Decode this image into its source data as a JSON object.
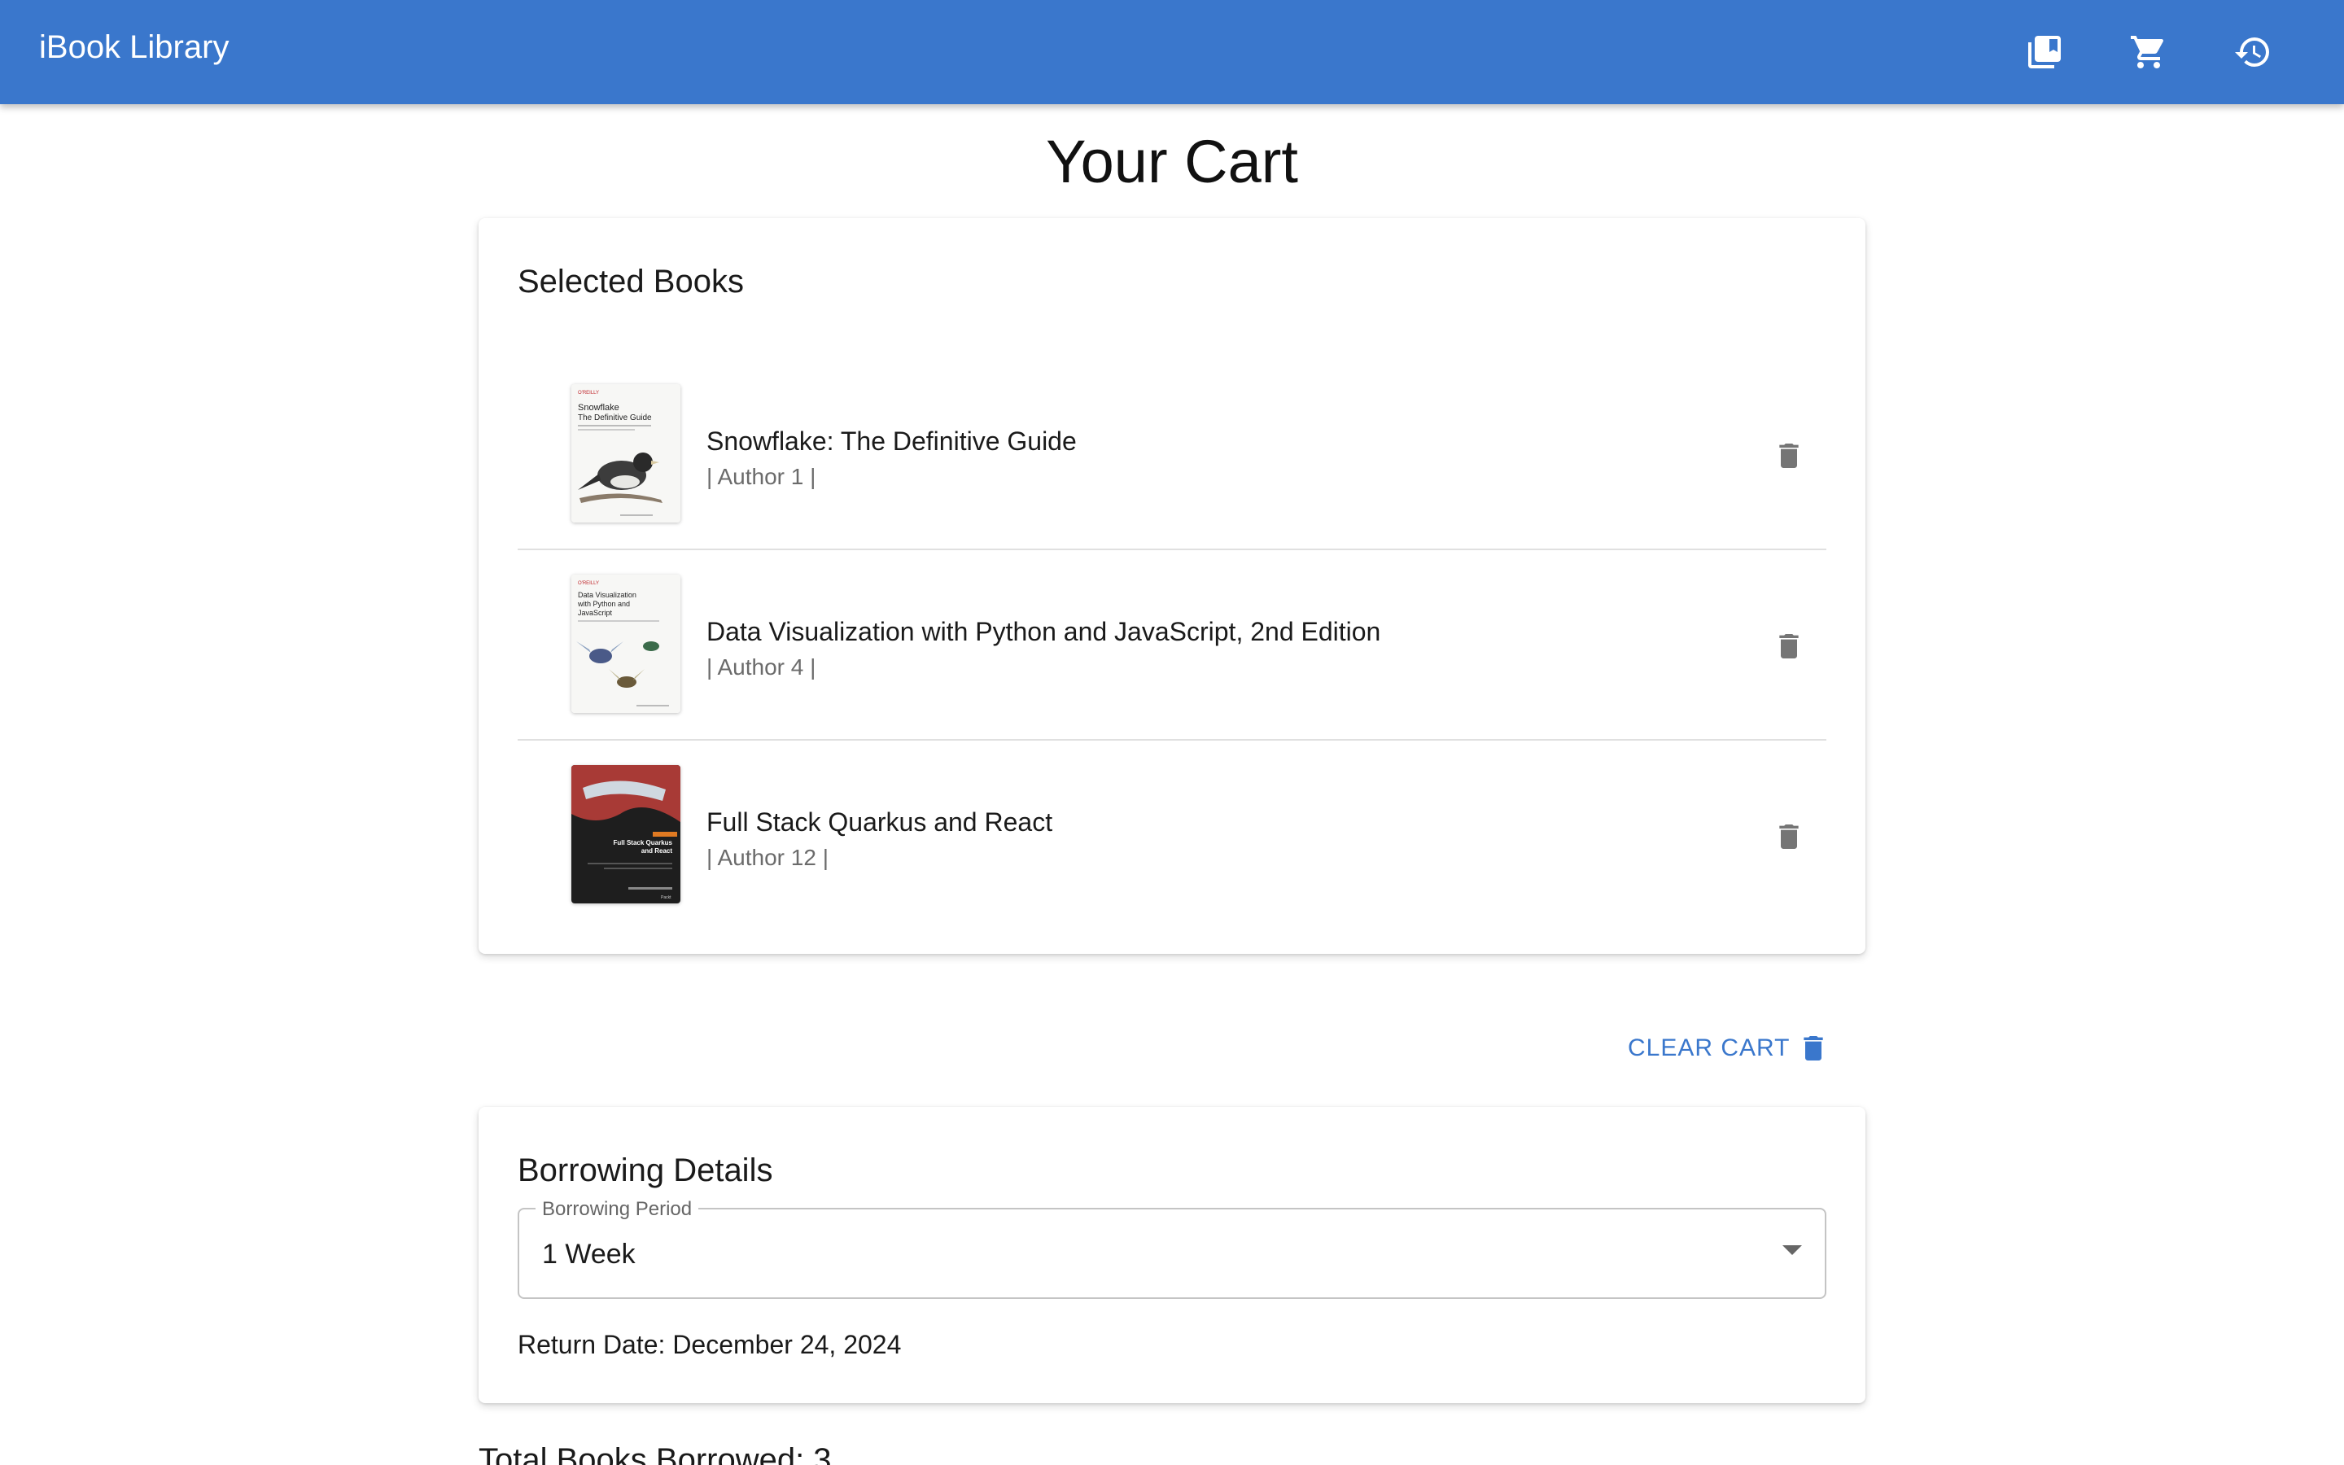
{
  "app": {
    "title": "iBook Library",
    "header_icons": [
      "library-books-icon",
      "shopping-cart-icon",
      "history-icon"
    ],
    "brand_color": "#3a77cc"
  },
  "page": {
    "title": "Your Cart"
  },
  "selected_books": {
    "heading": "Selected Books",
    "items": [
      {
        "title": "Snowflake: The Definitive Guide",
        "author": "| Author 1 |",
        "cover": {
          "publisher": "O'REILLY",
          "cover_title": "Snowflake The Definitive Guide",
          "icon": "bird-illustration"
        }
      },
      {
        "title": "Data Visualization with Python and JavaScript, 2nd Edition",
        "author": "| Author 4 |",
        "cover": {
          "publisher": "O'REILLY",
          "cover_title": "Data Visualization with Python and JavaScript",
          "icon": "insect-illustration"
        }
      },
      {
        "title": "Full Stack Quarkus and React",
        "author": "| Author 12 |",
        "cover": {
          "publisher": "Packt",
          "cover_title": "Full Stack Quarkus and React",
          "icon": "car-photo"
        }
      }
    ]
  },
  "clear_cart": {
    "label": "CLEAR CART",
    "icon": "delete-icon"
  },
  "borrowing": {
    "heading": "Borrowing Details",
    "period_label": "Borrowing Period",
    "period_value": "1 Week",
    "return_date": "Return Date: December 24, 2024"
  },
  "summary": {
    "total_books": "Total Books Borrowed: 3"
  }
}
